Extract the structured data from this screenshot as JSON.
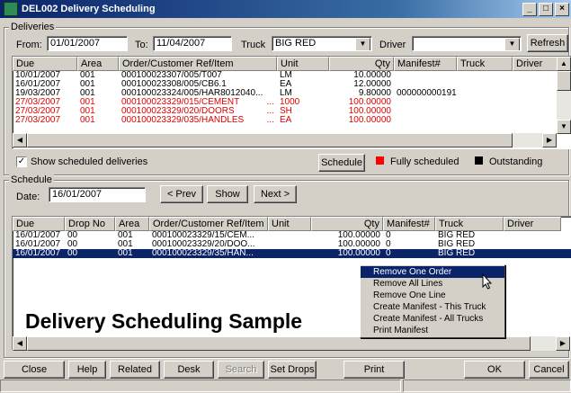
{
  "window": {
    "title": "DEL002  Delivery Scheduling"
  },
  "deliveries": {
    "group_label": "Deliveries",
    "from_label": "From:",
    "from_value": "01/01/2007",
    "to_label": "To:",
    "to_value": "11/04/2007",
    "truck_label": "Truck",
    "truck_value": "BIG RED",
    "driver_label": "Driver",
    "driver_value": "",
    "refresh_label": "Refresh",
    "columns": [
      "Due",
      "Area",
      "Order/Customer Ref/Item",
      "Unit",
      "Qty",
      "Manifest#",
      "Truck",
      "Driver"
    ],
    "rows": [
      {
        "due": "10/01/2007",
        "area": "001",
        "item": "000100023307/005/T007",
        "unit": "LM",
        "qty": "10.00000",
        "manifest": "",
        "truck": "",
        "driver": "",
        "red": false
      },
      {
        "due": "16/01/2007",
        "area": "001",
        "item": "000100023308/005/CB6.1",
        "unit": "EA",
        "qty": "12.00000",
        "manifest": "",
        "truck": "",
        "driver": "",
        "red": false
      },
      {
        "due": "19/03/2007",
        "area": "001",
        "item": "000100023324/005/HAR8012040...",
        "unit": "LM",
        "qty": "9.80000",
        "manifest": "000000000191",
        "truck": "",
        "driver": "",
        "red": false
      },
      {
        "due": "27/03/2007",
        "area": "001",
        "item": "000100023329/015/CEMENT",
        "dots": "...",
        "unit": "1000",
        "qty": "100.00000",
        "manifest": "",
        "truck": "",
        "driver": "",
        "red": true
      },
      {
        "due": "27/03/2007",
        "area": "001",
        "item": "000100023329/020/DOORS",
        "dots": "...",
        "unit": "SH",
        "qty": "100.00000",
        "manifest": "",
        "truck": "",
        "driver": "",
        "red": true
      },
      {
        "due": "27/03/2007",
        "area": "001",
        "item": "000100023329/035/HANDLES",
        "dots": "...",
        "unit": "EA",
        "qty": "100.00000",
        "manifest": "",
        "truck": "",
        "driver": "",
        "red": true
      }
    ],
    "show_scheduled_label": "Show scheduled deliveries",
    "show_scheduled_checked": true,
    "schedule_button": "Schedule",
    "legend_fully": "Fully scheduled",
    "legend_outstanding": "Outstanding",
    "colors": {
      "fully": "#ff0000",
      "outstanding": "#000000"
    }
  },
  "schedule": {
    "group_label": "Schedule",
    "date_label": "Date:",
    "date_value": "16/01/2007",
    "prev_label": "< Prev",
    "show_label": "Show",
    "next_label": "Next >",
    "columns": [
      "Due",
      "Drop No",
      "Area",
      "Order/Customer Ref/Item",
      "Unit",
      "Qty",
      "Manifest#",
      "Truck",
      "Driver"
    ],
    "rows": [
      {
        "due": "16/01/2007",
        "drop": "00",
        "area": "001",
        "item": "000100023329/15/CEM...",
        "unit": "",
        "qty": "100.00000",
        "manifest": "0",
        "truck": "BIG RED",
        "driver": "",
        "selected": false
      },
      {
        "due": "16/01/2007",
        "drop": "00",
        "area": "001",
        "item": "000100023329/20/DOO...",
        "unit": "",
        "qty": "100.00000",
        "manifest": "0",
        "truck": "BIG RED",
        "driver": "",
        "selected": false
      },
      {
        "due": "16/01/2007",
        "drop": "00",
        "area": "001",
        "item": "000100023329/35/HAN...",
        "unit": "",
        "qty": "100.00000",
        "manifest": "0",
        "truck": "BIG RED",
        "driver": "",
        "selected": true
      }
    ]
  },
  "context_menu": {
    "items": [
      "Remove One Order",
      "Remove All Lines",
      "Remove One Line",
      "Create Manifest - This Truck",
      "Create Manifest - All Trucks",
      "Print Manifest"
    ],
    "highlighted": 0
  },
  "overlay_text": "Delivery Scheduling Sample",
  "toolbar": {
    "close": "Close",
    "help": "Help",
    "related": "Related",
    "desk": "Desk",
    "search": "Search",
    "set_drops": "Set Drops",
    "print": "Print",
    "ok": "OK",
    "cancel": "Cancel"
  }
}
